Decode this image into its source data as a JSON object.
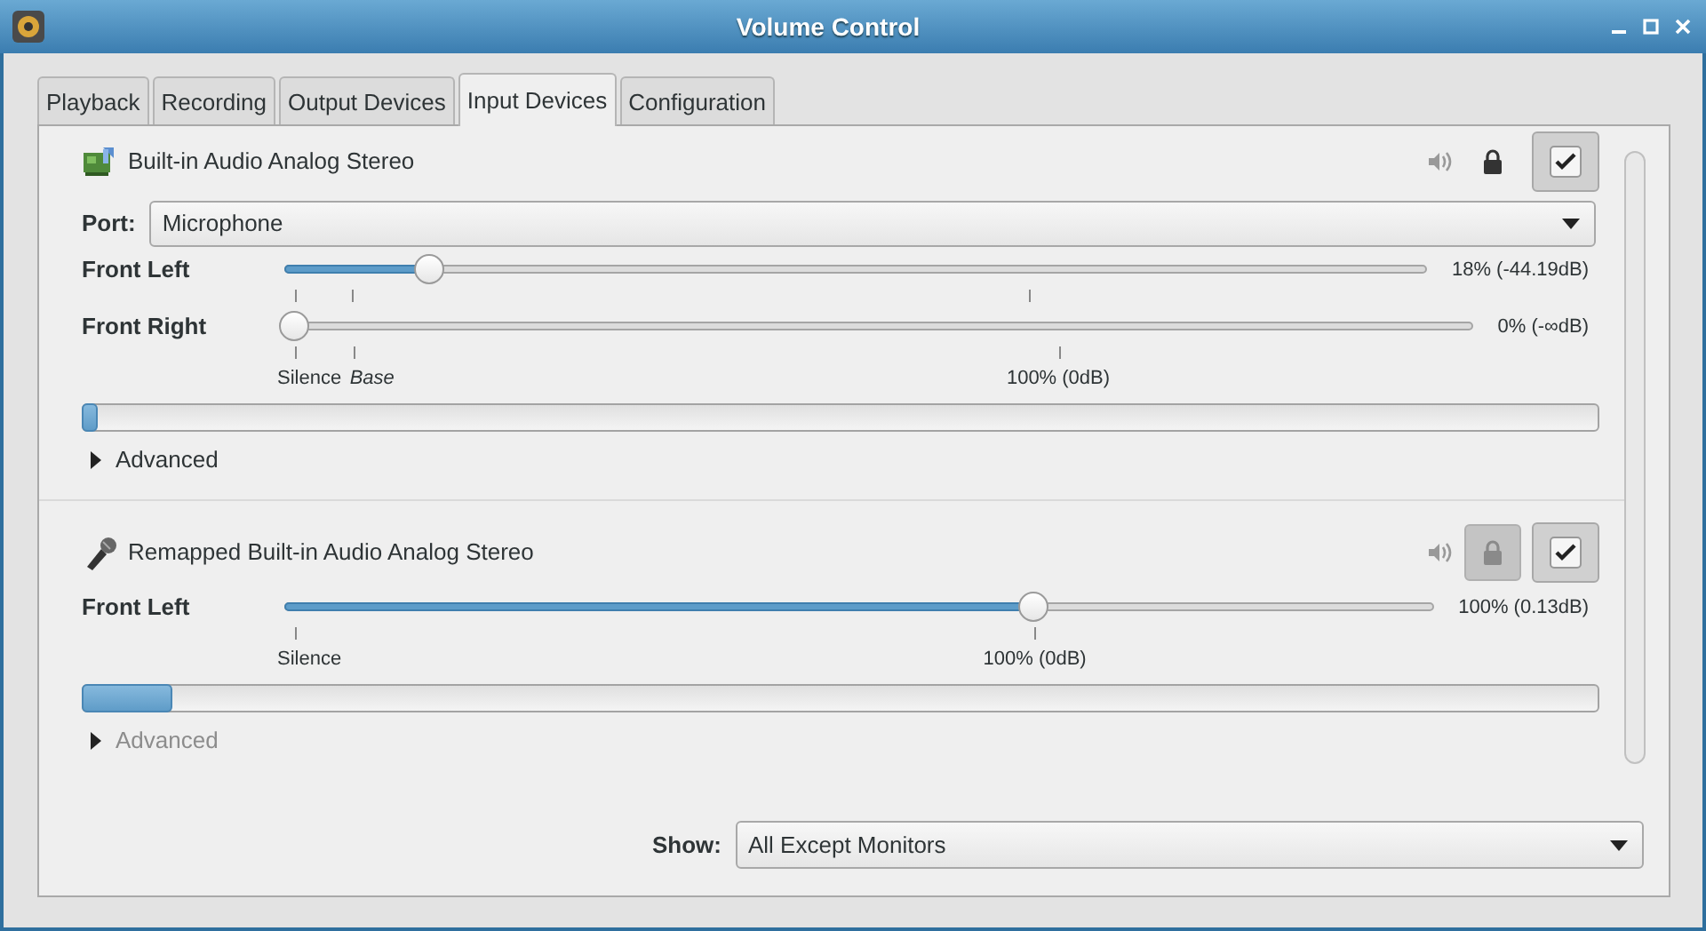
{
  "window": {
    "title": "Volume Control"
  },
  "tabs": [
    {
      "label": "Playback",
      "selected": false
    },
    {
      "label": "Recording",
      "selected": false
    },
    {
      "label": "Output Devices",
      "selected": false
    },
    {
      "label": "Input Devices",
      "selected": true
    },
    {
      "label": "Configuration",
      "selected": false
    }
  ],
  "devices": [
    {
      "name": "Built-in Audio Analog Stereo",
      "lock_disabled": false,
      "default": true,
      "port": {
        "label": "Port:",
        "value": "Microphone"
      },
      "channels": [
        {
          "name": "Front Left",
          "level": 0.12,
          "reading": "18% (-44.19dB)",
          "marks": [
            {
              "level": 0
            },
            {
              "level": 0.05
            },
            {
              "level": 0.654
            }
          ]
        },
        {
          "name": "Front Right",
          "level": 0,
          "reading": "0% (-∞dB)",
          "marks": [
            {
              "level": 0,
              "label": "Silence",
              "kind": "plain"
            },
            {
              "level": 0.05,
              "label": "Base",
              "kind": "base"
            },
            {
              "level": 0.654,
              "label": "100% (0dB)",
              "kind": "plain"
            }
          ]
        }
      ],
      "meter": {
        "level": 0.01
      },
      "advanced": {
        "label": "Advanced",
        "expanded": false,
        "disabled": false
      }
    },
    {
      "name": "Remapped Built-in Audio Analog Stereo",
      "lock_disabled": true,
      "default": true,
      "channels": [
        {
          "name": "Front Left",
          "level": 0.656,
          "reading": "100% (0.13dB)",
          "marks": [
            {
              "level": 0,
              "label": "Silence",
              "kind": "plain"
            },
            {
              "level": 0.656,
              "label": "100% (0dB)",
              "kind": "plain"
            }
          ]
        }
      ],
      "meter": {
        "level": 0.06
      },
      "advanced": {
        "label": "Advanced",
        "expanded": false,
        "disabled": true
      }
    }
  ],
  "show": {
    "label": "Show:",
    "value": "All Except Monitors"
  }
}
